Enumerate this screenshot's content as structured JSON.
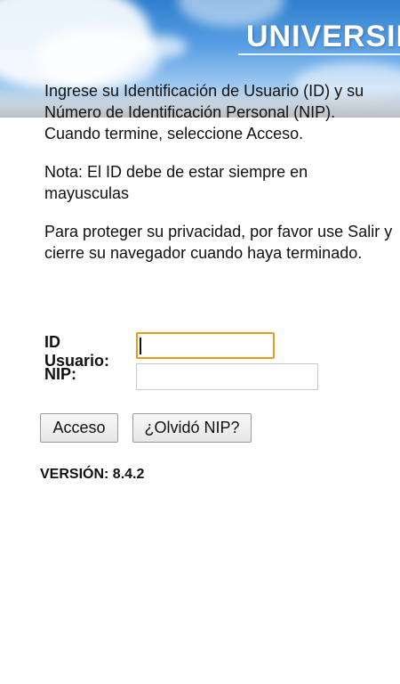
{
  "header": {
    "banner_text": "UNIVERSID"
  },
  "instructions": {
    "p1": "Ingrese su Identificación de Usuario (ID) y su Número de Identificación Personal (NIP). Cuando termine, seleccione Acceso.",
    "p2": "Nota: El ID debe de estar siempre en mayusculas",
    "p3": "Para proteger su privacidad, por favor use Salir y cierre su navegador cuando haya terminado."
  },
  "form": {
    "id_label": "ID Usuario:",
    "id_value": "",
    "nip_label": "NIP:",
    "nip_value": ""
  },
  "buttons": {
    "login": "Acceso",
    "forgot_pin": "¿Olvidó NIP?"
  },
  "footer": {
    "version": "VERSIÓN: 8.4.2"
  },
  "colors": {
    "focus_border": "#e79a1b",
    "banner_sky": "#5aa0e4"
  }
}
